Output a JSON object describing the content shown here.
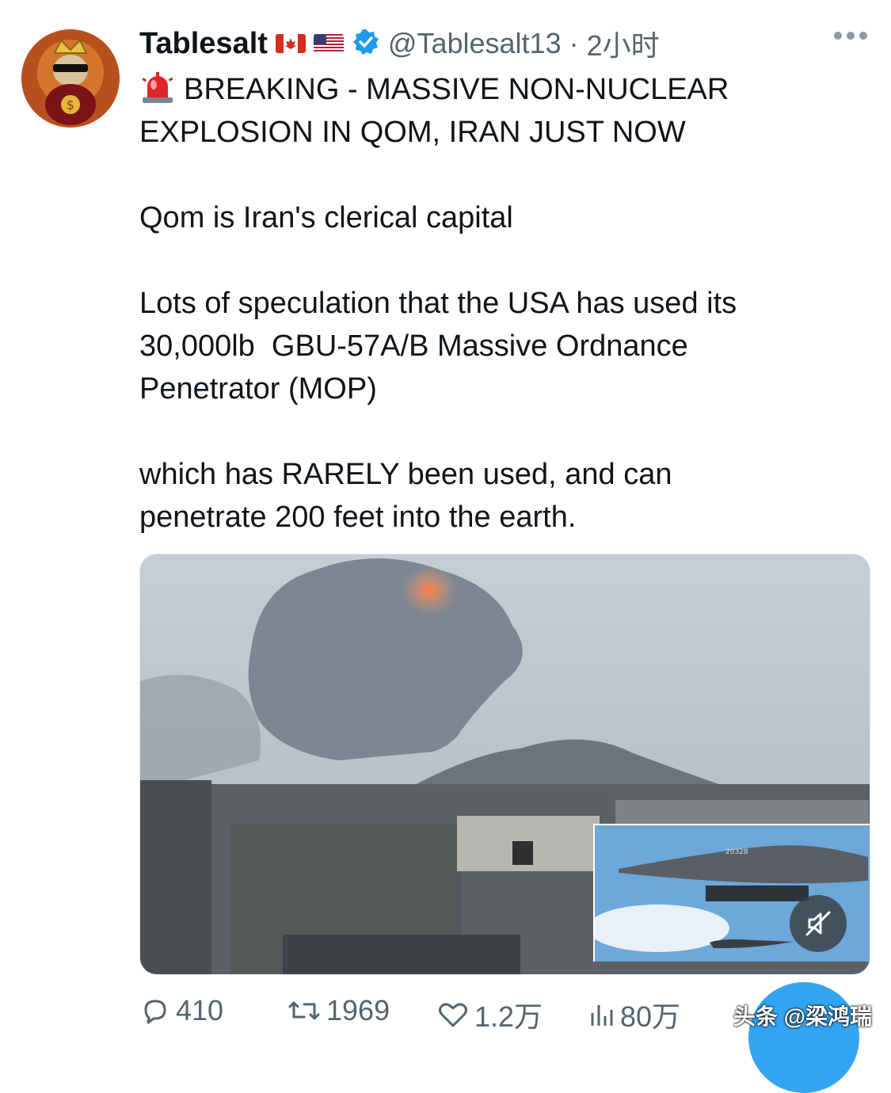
{
  "author": {
    "name": "Tablesalt",
    "handle": "@Tablesalt13",
    "separator": "·",
    "time": "2小时",
    "flags": [
      "canada-flag-icon",
      "usa-flag-icon"
    ],
    "verified_color": "#1d9bf0"
  },
  "tweet": {
    "paragraph1_line1": "BREAKING - MASSIVE NON-NUCLEAR",
    "paragraph1_line2": "EXPLOSION IN QOM, IRAN JUST NOW",
    "paragraph2": "Qom is Iran's clerical capital",
    "paragraph3_line1": "Lots of speculation that the USA has used its",
    "paragraph3_line2": "30,000lb  GBU-57A/B Massive Ordnance",
    "paragraph3_line3": "Penetrator (MOP)",
    "paragraph4_line1": "which has RARELY been used, and can",
    "paragraph4_line2": "penetrate 200 feet into the earth."
  },
  "media": {
    "inset_aircraft_label": "20328",
    "mute_icon": "muted-speaker-icon"
  },
  "actions": {
    "replies": "410",
    "retweets": "1969",
    "likes": "1.2万",
    "views": "80万"
  },
  "watermark": "头条 @梁鸿瑞",
  "colors": {
    "text": "#0f1419",
    "secondary": "#536471",
    "accent": "#1d9bf0"
  }
}
